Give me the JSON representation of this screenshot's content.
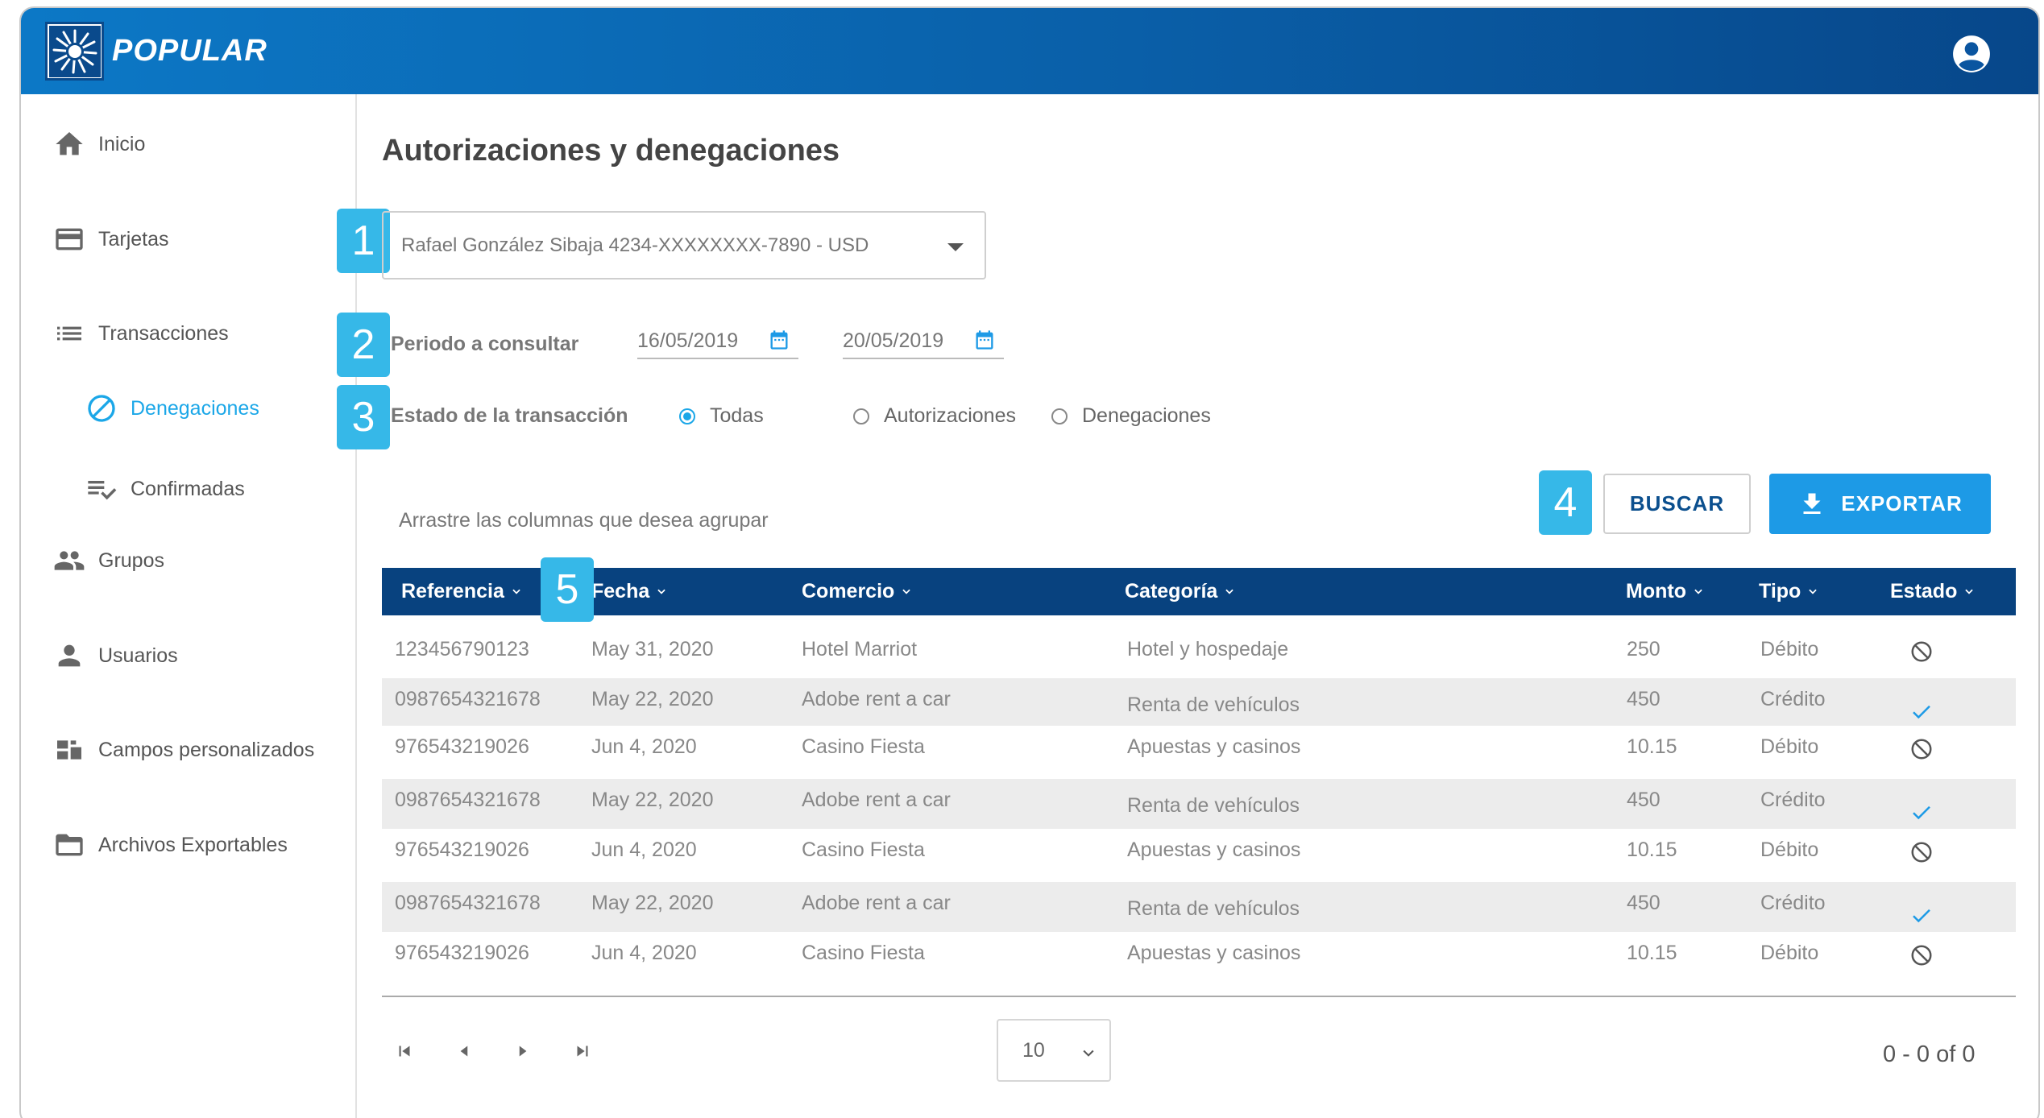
{
  "header": {
    "brand": "POPULAR",
    "logo_icon": "popular-sun-logo-icon",
    "account_icon": "account-circle-icon",
    "color_start": "#0c78c6",
    "color_end": "#07478a"
  },
  "sidebar": {
    "items": [
      {
        "label": "Inicio",
        "icon": "home-icon"
      },
      {
        "label": "Tarjetas",
        "icon": "credit-card-icon"
      },
      {
        "label": "Transacciones",
        "icon": "list-icon"
      },
      {
        "label": "Denegaciones",
        "icon": "block-icon",
        "active": true
      },
      {
        "label": "Confirmadas",
        "icon": "playlist-check-icon"
      },
      {
        "label": "Grupos",
        "icon": "people-icon"
      },
      {
        "label": "Usuarios",
        "icon": "person-icon"
      },
      {
        "label": "Campos personalizados",
        "icon": "dashboard-customize-icon"
      },
      {
        "label": "Archivos Exportables",
        "icon": "folder-icon"
      }
    ],
    "active_color": "#1ba7e8"
  },
  "page": {
    "title": "Autorizaciones y denegaciones"
  },
  "steps": [
    "1",
    "2",
    "3",
    "4",
    "5"
  ],
  "card_select": {
    "value": "Rafael González Sibaja  4234-XXXXXXXX-7890 - USD"
  },
  "period": {
    "label": "Periodo a consultar",
    "from": "16/05/2019",
    "to": "20/05/2019"
  },
  "status_filter": {
    "label": "Estado de la transacción",
    "options": [
      "Todas",
      "Autorizaciones",
      "Denegaciones"
    ],
    "selected": "Todas"
  },
  "drag_hint": "Arrastre las columnas que desea agrupar",
  "actions": {
    "search_label": "BUSCAR",
    "export_label": "EXPORTAR"
  },
  "table": {
    "columns": [
      "Referencia",
      "Fecha",
      "Comercio",
      "Categoría",
      "Monto",
      "Tipo",
      "Estado"
    ],
    "rows": [
      {
        "ref": "123456790123",
        "date": "May 31, 2020",
        "merchant": "Hotel Marriot",
        "category": "Hotel y hospedaje",
        "amount": "250",
        "type": "Débito",
        "status": "denied"
      },
      {
        "ref": "0987654321678",
        "date": "May 22, 2020",
        "merchant": "Adobe rent a car",
        "category": "Renta de vehículos",
        "amount": "450",
        "type": "Crédito",
        "status": "approved"
      },
      {
        "ref": "976543219026",
        "date": "Jun 4, 2020",
        "merchant": "Casino Fiesta",
        "category": "Apuestas y casinos",
        "amount": "10.15",
        "type": "Débito",
        "status": "denied"
      },
      {
        "ref": "0987654321678",
        "date": "May 22, 2020",
        "merchant": "Adobe rent a car",
        "category": "Renta de vehículos",
        "amount": "450",
        "type": "Crédito",
        "status": "approved"
      },
      {
        "ref": "976543219026",
        "date": "Jun 4, 2020",
        "merchant": "Casino Fiesta",
        "category": "Apuestas y casinos",
        "amount": "10.15",
        "type": "Débito",
        "status": "denied"
      },
      {
        "ref": "0987654321678",
        "date": "May 22, 2020",
        "merchant": "Adobe rent a car",
        "category": "Renta de vehículos",
        "amount": "450",
        "type": "Crédito",
        "status": "approved"
      },
      {
        "ref": "976543219026",
        "date": "Jun 4, 2020",
        "merchant": "Casino Fiesta",
        "category": "Apuestas y casinos",
        "amount": "10.15",
        "type": "Débito",
        "status": "denied"
      }
    ],
    "header_color": "#08427f",
    "approved_color": "#1d9ae6"
  },
  "pagination": {
    "page_size": "10",
    "range": "0 - 0 of 0"
  }
}
